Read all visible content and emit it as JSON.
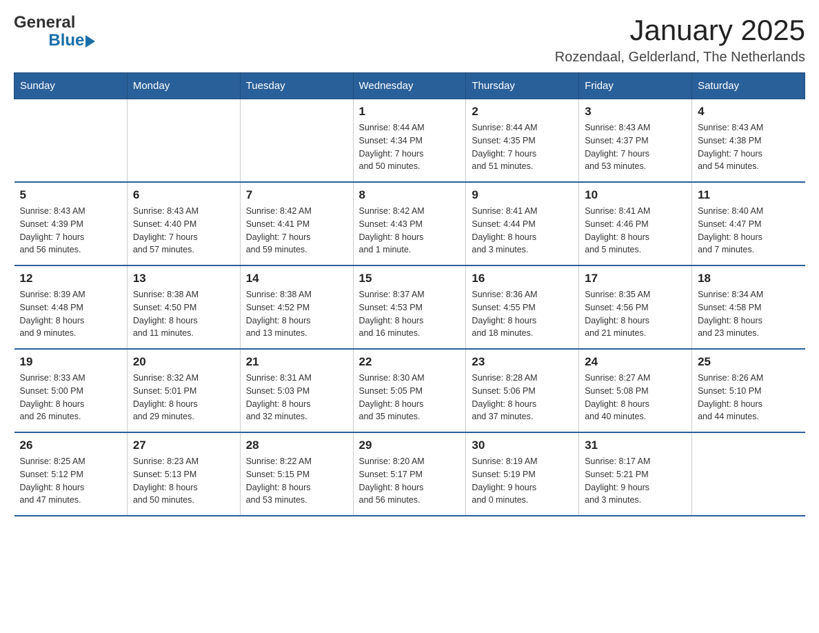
{
  "header": {
    "logo": {
      "text_general": "General",
      "text_blue": "Blue",
      "aria": "GeneralBlue logo"
    },
    "title": "January 2025",
    "subtitle": "Rozendaal, Gelderland, The Netherlands"
  },
  "calendar": {
    "days_of_week": [
      "Sunday",
      "Monday",
      "Tuesday",
      "Wednesday",
      "Thursday",
      "Friday",
      "Saturday"
    ],
    "weeks": [
      {
        "days": [
          {
            "number": "",
            "info": ""
          },
          {
            "number": "",
            "info": ""
          },
          {
            "number": "",
            "info": ""
          },
          {
            "number": "1",
            "info": "Sunrise: 8:44 AM\nSunset: 4:34 PM\nDaylight: 7 hours\nand 50 minutes."
          },
          {
            "number": "2",
            "info": "Sunrise: 8:44 AM\nSunset: 4:35 PM\nDaylight: 7 hours\nand 51 minutes."
          },
          {
            "number": "3",
            "info": "Sunrise: 8:43 AM\nSunset: 4:37 PM\nDaylight: 7 hours\nand 53 minutes."
          },
          {
            "number": "4",
            "info": "Sunrise: 8:43 AM\nSunset: 4:38 PM\nDaylight: 7 hours\nand 54 minutes."
          }
        ]
      },
      {
        "days": [
          {
            "number": "5",
            "info": "Sunrise: 8:43 AM\nSunset: 4:39 PM\nDaylight: 7 hours\nand 56 minutes."
          },
          {
            "number": "6",
            "info": "Sunrise: 8:43 AM\nSunset: 4:40 PM\nDaylight: 7 hours\nand 57 minutes."
          },
          {
            "number": "7",
            "info": "Sunrise: 8:42 AM\nSunset: 4:41 PM\nDaylight: 7 hours\nand 59 minutes."
          },
          {
            "number": "8",
            "info": "Sunrise: 8:42 AM\nSunset: 4:43 PM\nDaylight: 8 hours\nand 1 minute."
          },
          {
            "number": "9",
            "info": "Sunrise: 8:41 AM\nSunset: 4:44 PM\nDaylight: 8 hours\nand 3 minutes."
          },
          {
            "number": "10",
            "info": "Sunrise: 8:41 AM\nSunset: 4:46 PM\nDaylight: 8 hours\nand 5 minutes."
          },
          {
            "number": "11",
            "info": "Sunrise: 8:40 AM\nSunset: 4:47 PM\nDaylight: 8 hours\nand 7 minutes."
          }
        ]
      },
      {
        "days": [
          {
            "number": "12",
            "info": "Sunrise: 8:39 AM\nSunset: 4:48 PM\nDaylight: 8 hours\nand 9 minutes."
          },
          {
            "number": "13",
            "info": "Sunrise: 8:38 AM\nSunset: 4:50 PM\nDaylight: 8 hours\nand 11 minutes."
          },
          {
            "number": "14",
            "info": "Sunrise: 8:38 AM\nSunset: 4:52 PM\nDaylight: 8 hours\nand 13 minutes."
          },
          {
            "number": "15",
            "info": "Sunrise: 8:37 AM\nSunset: 4:53 PM\nDaylight: 8 hours\nand 16 minutes."
          },
          {
            "number": "16",
            "info": "Sunrise: 8:36 AM\nSunset: 4:55 PM\nDaylight: 8 hours\nand 18 minutes."
          },
          {
            "number": "17",
            "info": "Sunrise: 8:35 AM\nSunset: 4:56 PM\nDaylight: 8 hours\nand 21 minutes."
          },
          {
            "number": "18",
            "info": "Sunrise: 8:34 AM\nSunset: 4:58 PM\nDaylight: 8 hours\nand 23 minutes."
          }
        ]
      },
      {
        "days": [
          {
            "number": "19",
            "info": "Sunrise: 8:33 AM\nSunset: 5:00 PM\nDaylight: 8 hours\nand 26 minutes."
          },
          {
            "number": "20",
            "info": "Sunrise: 8:32 AM\nSunset: 5:01 PM\nDaylight: 8 hours\nand 29 minutes."
          },
          {
            "number": "21",
            "info": "Sunrise: 8:31 AM\nSunset: 5:03 PM\nDaylight: 8 hours\nand 32 minutes."
          },
          {
            "number": "22",
            "info": "Sunrise: 8:30 AM\nSunset: 5:05 PM\nDaylight: 8 hours\nand 35 minutes."
          },
          {
            "number": "23",
            "info": "Sunrise: 8:28 AM\nSunset: 5:06 PM\nDaylight: 8 hours\nand 37 minutes."
          },
          {
            "number": "24",
            "info": "Sunrise: 8:27 AM\nSunset: 5:08 PM\nDaylight: 8 hours\nand 40 minutes."
          },
          {
            "number": "25",
            "info": "Sunrise: 8:26 AM\nSunset: 5:10 PM\nDaylight: 8 hours\nand 44 minutes."
          }
        ]
      },
      {
        "days": [
          {
            "number": "26",
            "info": "Sunrise: 8:25 AM\nSunset: 5:12 PM\nDaylight: 8 hours\nand 47 minutes."
          },
          {
            "number": "27",
            "info": "Sunrise: 8:23 AM\nSunset: 5:13 PM\nDaylight: 8 hours\nand 50 minutes."
          },
          {
            "number": "28",
            "info": "Sunrise: 8:22 AM\nSunset: 5:15 PM\nDaylight: 8 hours\nand 53 minutes."
          },
          {
            "number": "29",
            "info": "Sunrise: 8:20 AM\nSunset: 5:17 PM\nDaylight: 8 hours\nand 56 minutes."
          },
          {
            "number": "30",
            "info": "Sunrise: 8:19 AM\nSunset: 5:19 PM\nDaylight: 9 hours\nand 0 minutes."
          },
          {
            "number": "31",
            "info": "Sunrise: 8:17 AM\nSunset: 5:21 PM\nDaylight: 9 hours\nand 3 minutes."
          },
          {
            "number": "",
            "info": ""
          }
        ]
      }
    ]
  }
}
